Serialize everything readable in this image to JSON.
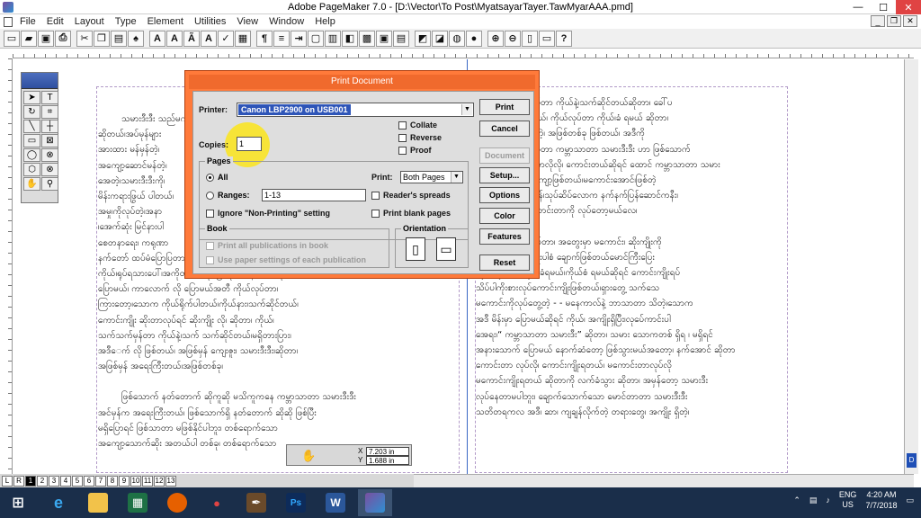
{
  "window": {
    "title": "Adobe PageMaker 7.0 - [D:\\Vector\\To Post\\MyatsayarTayer.TawMyarAAA.pmd]",
    "minimize": "—",
    "maximize": "☐",
    "close": "✕"
  },
  "menu": [
    "File",
    "Edit",
    "Layout",
    "Type",
    "Element",
    "Utilities",
    "View",
    "Window",
    "Help"
  ],
  "document": {
    "left_column": [
      "သမားဒီးဒီး သည်မက် လက်သူကျပ်",
      "ဆိုတယ်၊အပ်မုန်များ",
      "အားထား မန်မှန်တဲ့၊",
      "အကျော့ဆောင်မန်တဲ့၊",
      "အေတဲ့၊သမားဒီးဒီးကို၊",
      "မိန်းကရားဖြွယ် ပါတယ်၊",
      "အမှု၊ကိုလုပ်တဲ့၊အနာ",
      "၊အေက်ဆုံး မြင်နားပါ",
      "စေတနာရေး၊ ကရုဏာ",
      "နက်တော် ထပ်မံပြောပြတာ",
      "ကိုယ်၊ရုပ်ရသားပေါ်၊အကိုတီး စာကိုပြောရင် မနေကာက်လို၊",
      "ပြောမယ်၊ ကာလောက် လို ပြောမယ်အတီ ကိုယ်လုပ်တာ၊",
      "ကြားတော့၊သောက ကိုယ်ရိုက်ပါတယ်၊ကိုယ်နား၊သက်ဆိုင်တယ်၊",
      "ကောင်းကျိုး ဆိုးတာလုပ်ရင် ဆိုးကျိုး လို၊ ဆိုတာ၊ ကိုယ်၊",
      "သက်သက်မှန်တာ ကိုယ်နဲ့၊သက် သက်ဆိုင်တယ်၊မရှိတားပြား၊",
      "အဒီေက် လို ဖြစ်တယ်၊ အဖြစ်မှန် ကျေးဇူး၊ သမားဒီးဒီး၊ဆိုတာ၊",
      "အဖြစ်မှန် အရေးကြီးတယ်၊အဖြစ်တစ်ခု၊",
      "",
      "ဖြစ်သောက် နတ်တောက် ဆိုကူဆို မသိကူကနေ ကမ္ဘာသာတာ သမားဒီးဒီး",
      "အင်မှန်က အရေးကြီးတယ်၊ ဖြစ်သောက်ရှိ နတ်တောက် ဆိုဆို ဖြစ်ပြီး",
      "မရှိပြောရင် ဖြစ်သာတာ မဖြစ်နိုင်ပါဘူး၊ တစ်ရောက်သော",
      "အကျော့သောက်ဆိုး အတယ်ပါ တစ်ခု၊ တစ်ရောက်သော"
    ],
    "right_column": [
      "အကျိုးကို ကိုယ်လုပ်တာ ကိုယ်နဲ့၊သက်ဆိုင်တယ်ဆိုတာ၊ ခေါ်ပ",
      "လုပ်တာ ကိုယ်ခံရမယ်၊ ကိုယ်လုပ်တာ ကိုယ်၊ခံ ရမယ် ဆိုတာ၊",
      "အင်မှန် အရေးကြီးတဲ့၊ အဖြစ်တစ်ခု ဖြစ်တယ်၊ အဒီကို",
      "သမားဒီးဒီး လို၊ ပြောတာ ကမ္ဘာသာတာ သမားဒီးဒီး ဟာ ဖြစ်သောက်",
      "ခုတ်တယ်၊ရှိတယ်၊ဘာလိုလို၊ ကောင်းတယ်ဆိုရင် ထောင် ကမ္ဘာသာတာ သမား",
      "ဒီးဒီး သူးရှိတာ၊ အကျော့ဖြစ်တယ်၊မကောင်းအောင်၊ဖြစ်တဲ့",
      "သိမ်မွေးပြန် လက်မှန်၊သုပ်ဆိပ်လောက နက်နက်ပြန်ဆောင်ကနီး၊",
      "သမား မောင်ပြီး ကောင်းတာကို လုပ်တော့မယ်လေ၊",
      "",
      "လုပ်၊ သက်ပွဲမှာ လုပ်တာ၊ အတွေးမှာ မကောင်း၊ ဆိုးကျိုးကို",
      "ပြီးသွား၊ ကောင်းကျိုးပါစံ ချောက်ဖြစ်တယ်မောင်ကြီးပြေး",
      "ကိုယ်လုပ်တာ ကိုယ်ခံရမယ်၊ကိုယ်စံ ရမယ်ဆိုရင် ကောင်းကျိုးရပ်",
      "သိပ်ပါကိုးစားလုပ်ကောင်းကျိုးဖြစ်တယ်၊ရှားတွေ့ သက်သေ",
      "မကောင်းကိုလုပ်တွေ့တဲ့ - - မနေကာလ်နဲ့ ဘာသာတာ သိတဲ့၊သောက",
      "အဒီ မိန်းမှာ ပြောမယ်ဆိုရင် ကိုယ်၊ အကျိုးရှိပြီး၊လုပ်ေကာင်းပါ",
      "အေရး၊“ ကမ္ဘာသာတာ သမားဒီး” ဆိုတာ၊ သမား သောကတစ် ရှိရ ၊ မရှိရင်",
      "အနားသောက် ပြောမယ် နောက်ဆံတော့ ဖြစ်သွားမယ်အတော့၊ နက်အောင် ဆိုတာ",
      "ကောင်းတာ လုပ်လို၊ ကောင်းကျိုးရတယ်၊ မကောင်းတာလုပ်လို",
      "မကောင်းကျိုးရတယ် ဆိုတာကို လက်ခံသွား ဆိုတာ၊ အမှန်တော့ သမားဒီး",
      "လုပ်နေတာမပါဘူး၊ ချောက်သောက်သော မောင်တာတာ သမားဒီးဒီး",
      "သတိတရကလ အဒီ၊ ဆာ၊ ကျချန်လိုက်တဲ့ တရားတွေ၊ အကျိုး ရှိတဲ့၊"
    ]
  },
  "dialog": {
    "title": "Print Document",
    "printer_label": "Printer:",
    "printer_value": "Canon LBP2900 on USB001",
    "copies_label": "Copies:",
    "copies_value": "1",
    "collate": "Collate",
    "reverse": "Reverse",
    "proof": "Proof",
    "pages_title": "Pages",
    "all": "All",
    "ranges": "Ranges:",
    "ranges_value": "1-13",
    "print_label": "Print:",
    "print_value": "Both Pages",
    "readers_spreads": "Reader's spreads",
    "ignore_nonprinting": "Ignore \"Non-Printing\" setting",
    "print_blank_pages": "Print blank pages",
    "book_title": "Book",
    "print_all_pubs": "Print all publications in book",
    "use_paper_settings": "Use paper settings of each publication",
    "orientation_title": "Orientation",
    "buttons": {
      "print": "Print",
      "cancel": "Cancel",
      "document": "Document",
      "setup": "Setup...",
      "options": "Options",
      "color": "Color",
      "features": "Features",
      "reset": "Reset"
    }
  },
  "coords": {
    "x_label": "X",
    "x_value": "7.203 in",
    "y_label": "Y",
    "y_value": "1.688 in"
  },
  "page_tabs": [
    "L",
    "R",
    "1",
    "2",
    "3",
    "4",
    "5",
    "6",
    "7",
    "8",
    "9",
    "10",
    "11",
    "12",
    "13"
  ],
  "active_page": "1",
  "taskbar": {
    "lang": "ENG",
    "region": "US",
    "time": "4:20 AM",
    "date": "7/7/2018",
    "ps_label": "Ps",
    "word_label": "W"
  }
}
